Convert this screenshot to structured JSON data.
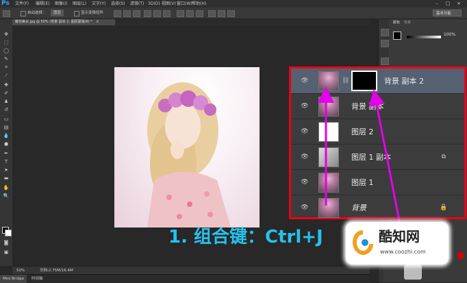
{
  "app": {
    "logo": "Ps"
  },
  "menu": {
    "items": [
      "文件(F)",
      "编辑(E)",
      "图像(I)",
      "图层(L)",
      "文字(Y)",
      "选择(S)",
      "滤镜(T)",
      "3D(D)",
      "视图(V)",
      "窗口(W)",
      "帮助(H)"
    ],
    "window_controls": [
      "–",
      "□",
      "×"
    ]
  },
  "options": {
    "auto_select": "自动选择：",
    "layer_dropdown": "图层",
    "show_transform": "显示变换控件",
    "workspace": "基本功能"
  },
  "document": {
    "tab_title": "戴花美女.jpg @ 50% (背景 副本 2, 图层蒙版/8) *",
    "tab_close": "×"
  },
  "status": {
    "zoom": "50%",
    "doc_info": "文档:2.75M/16.4M",
    "minibridge_tabs": [
      "Mini Bridge",
      "时间轴"
    ]
  },
  "color_panel": {
    "tabs": [
      "颜色",
      "色板"
    ],
    "value": "100",
    "unit": "%"
  },
  "layers": [
    {
      "name": "背景 副本 2",
      "thumb": "photo",
      "has_mask": true,
      "selected": true,
      "badge": ""
    },
    {
      "name": "背景 副本",
      "thumb": "photo",
      "has_mask": false,
      "selected": false,
      "badge": ""
    },
    {
      "name": "图层 2",
      "thumb": "white",
      "has_mask": false,
      "selected": false,
      "badge": ""
    },
    {
      "name": "图层 1 副本",
      "thumb": "gray",
      "has_mask": false,
      "selected": false,
      "badge": "⧉"
    },
    {
      "name": "图层 1",
      "thumb": "photo",
      "has_mask": false,
      "selected": false,
      "badge": ""
    },
    {
      "name": "背景",
      "thumb": "photo",
      "has_mask": false,
      "selected": false,
      "badge": "🔒",
      "italic": true
    }
  ],
  "annotation": {
    "shortcut": "1. 组合键：Ctrl+J",
    "arrow_color": "#e400e8",
    "border_color": "#ee0016",
    "text_color": "#25c2ee"
  },
  "watermark": {
    "title": "酷知网",
    "url": "www.coozhi.com"
  }
}
